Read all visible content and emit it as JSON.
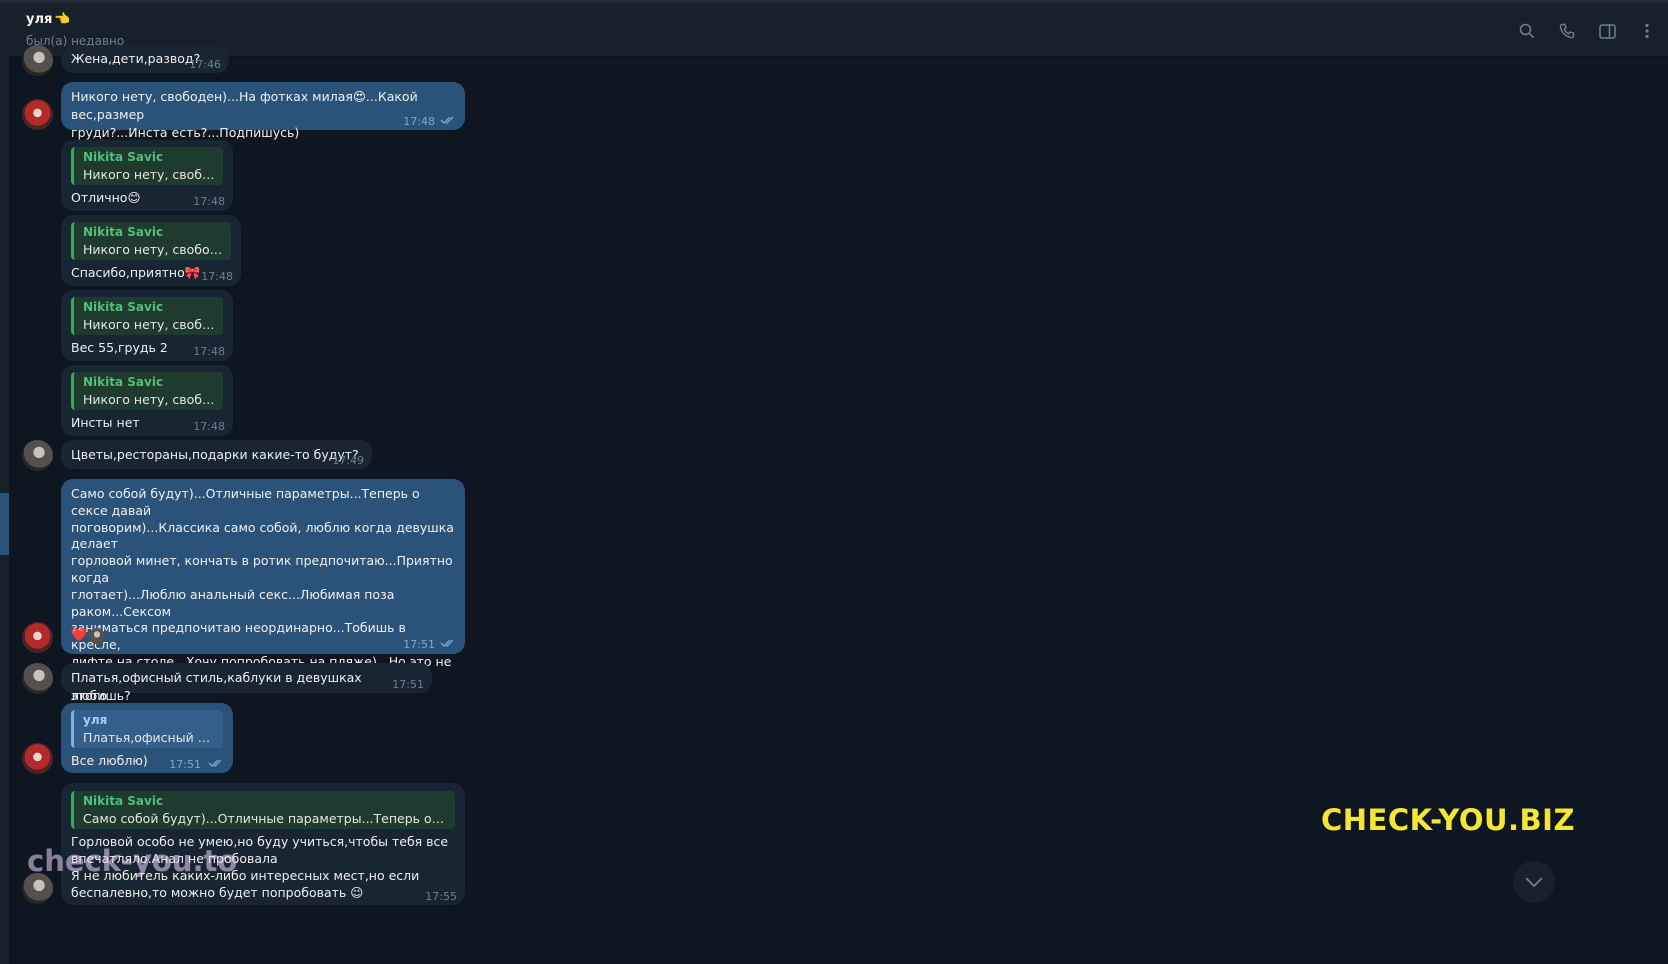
{
  "header": {
    "name": "уля",
    "name_emoji": "👈",
    "status": "был(а) недавно"
  },
  "colors": {
    "background": "#0e1621",
    "incoming_bubble": "#182533",
    "outgoing_bubble": "#2b5278",
    "reply_name_green": "#53bf79",
    "watermark_yellow": "#f5e534"
  },
  "icons": [
    "search-icon",
    "phone-icon",
    "sidebar-toggle-icon",
    "more-vert-icon"
  ],
  "messages": [
    {
      "text": "Жена,дети,развод?",
      "time": "17:46"
    },
    {
      "text": "Никого нету, свободен)...На фотках милая😍...Какой вес,размер\nгруди?...Инста есть?...Подпишусь)",
      "time": "17:48"
    },
    {
      "reply_name": "Nikita Savic",
      "reply_text": "Никого нету, свободе...",
      "text": "Отлично😊",
      "time": "17:48"
    },
    {
      "reply_name": "Nikita Savic",
      "reply_text": "Никого нету, свободен...",
      "text": "Спасибо,приятно🎀",
      "time": "17:48"
    },
    {
      "reply_name": "Nikita Savic",
      "reply_text": "Никого нету, свободе...",
      "text": "Вес 55,грудь 2",
      "time": "17:48"
    },
    {
      "reply_name": "Nikita Savic",
      "reply_text": "Никого нету, свободе...",
      "text": "Инсты нет",
      "time": "17:48"
    },
    {
      "text": "Цветы,рестораны,подарки какие-то будут?",
      "time": "17:49"
    },
    {
      "text": "Само собой будут)...Отличные параметры...Теперь о сексе давай\nпоговорим)...Классика само собой, люблю когда девушка делает\nгорловой минет, кончать в ротик предпочитаю...Приятно когда\nглотает)...Люблю анальный секс...Любимая поза раком...Сексом\nзаниматься предпочитаю неординарно...Тобишь в кресле,\nлифте,на столе...Хочу попробовать на пляже)...Но это не\nозначает что на кровати им не занимаюсь😊...Что из этого\nбыло, что нет?)",
      "time": "17:51",
      "reaction": "❤️"
    },
    {
      "text": "Платья,офисный стиль,каблуки в девушках любишь?",
      "time": "17:51"
    },
    {
      "reply_name": "уля",
      "reply_text": "Платья,офисный стил...",
      "text": "Все люблю)",
      "time": "17:51"
    },
    {
      "reply_name": "Nikita Savic",
      "reply_text": "Само собой будут)...Отличные параметры...Теперь о сексе да...",
      "text": "Горловой особо не умею,но буду учиться,чтобы тебя все\nвпечатляло.Анал не пробовала\nЯ не любитель каких-либо интересных мест,но если\nбеспалевно,то можно будет попробовать 😉",
      "time": "17:55"
    }
  ],
  "watermarks": {
    "right": "CHECK-YOU.BIZ",
    "left": "check-you.to"
  }
}
